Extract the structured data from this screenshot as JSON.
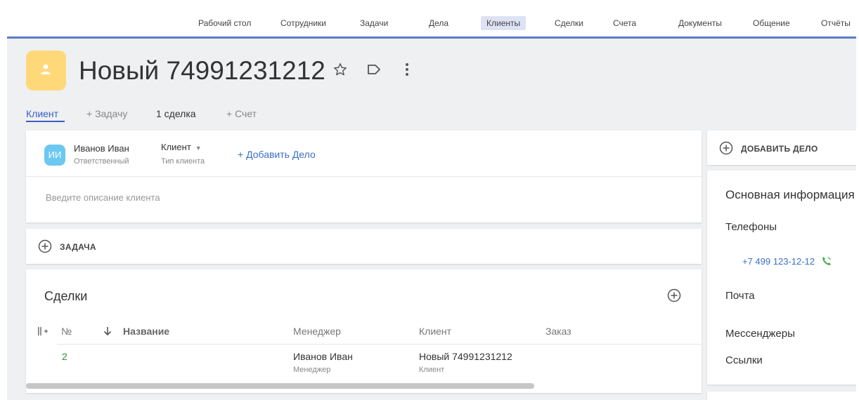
{
  "nav": {
    "items": [
      "Рабочий стол",
      "Сотрудники",
      "Задачи",
      "Дела",
      "Клиенты",
      "Сделки",
      "Счета",
      "Документы",
      "Общение",
      "Отчёты"
    ],
    "active": "Клиенты"
  },
  "header": {
    "title": "Новый 74991231212"
  },
  "tabs": {
    "client": "Клиент",
    "add_task": "+ Задачу",
    "deals": "1 сделка",
    "add_invoice": "+ Счет"
  },
  "main": {
    "responsible": {
      "initials": "ИИ",
      "name": "Иванов Иван",
      "role_label": "Ответственный"
    },
    "client_type": {
      "value": "Клиент",
      "label": "Тип клиента"
    },
    "add_deal_link": "+ Добавить Дело",
    "description_placeholder": "Введите описание клиента"
  },
  "task_button": "ЗАДАЧА",
  "deals": {
    "title": "Сделки",
    "columns": {
      "number": "№",
      "name": "Название",
      "manager": "Менеджер",
      "client": "Клиент",
      "order": "Заказ"
    },
    "rows": [
      {
        "number": "2",
        "name": "",
        "manager": "Иванов Иван",
        "manager_sub": "Менеджер",
        "client": "Новый 74991231212",
        "client_sub": "Клиент",
        "order": ""
      }
    ]
  },
  "sidebar": {
    "add_case": "ДОБАВИТЬ ДЕЛО",
    "info_title": "Основная информация",
    "phones_label": "Телефоны",
    "phone": "+7 499 123-12-12",
    "email_label": "Почта",
    "messengers_label": "Мессенджеры",
    "links_label": "Ссылки"
  },
  "colors": {
    "accent": "#5b7bc8",
    "link": "#3b6fc8",
    "avatar_bg": "#ffd87a",
    "resp_avatar_bg": "#6cc8f0",
    "phone_icon": "#4caf50",
    "deal_number": "#3a8a3a"
  }
}
